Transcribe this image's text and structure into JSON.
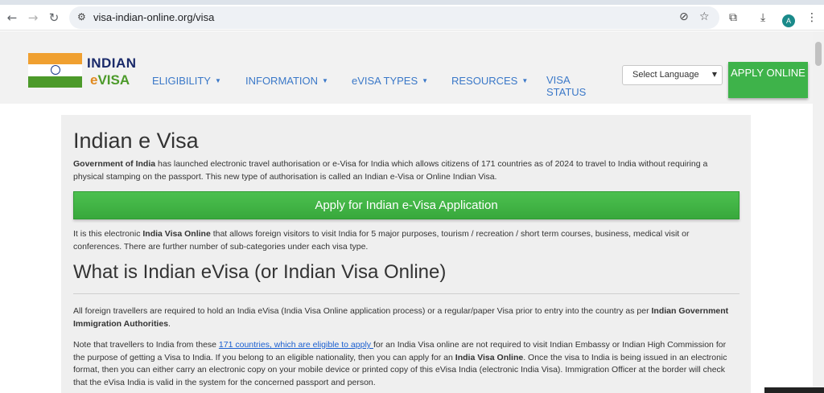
{
  "browser": {
    "url": "visa-indian-online.org/visa",
    "avatar_letter": "A"
  },
  "header": {
    "brand_line1": "INDIAN",
    "brand_line2_e": "e",
    "brand_line2_visa": "VISA",
    "nav": [
      {
        "label": "ELIGIBILITY"
      },
      {
        "label": "INFORMATION"
      },
      {
        "label": "eVISA TYPES"
      },
      {
        "label": "RESOURCES"
      }
    ],
    "visa_status": "VISA STATUS",
    "language_select": "Select Language",
    "apply_online": "APPLY ONLINE"
  },
  "main": {
    "title": "Indian e Visa",
    "intro_bold": "Government of India",
    "intro_rest": " has launched electronic travel authorisation or e-Visa for India which allows citizens of 171 countries as of 2024 to travel to India without requiring a physical stamping on the passport. This new type of authorisation is called an Indian e-Visa or Online Indian Visa.",
    "apply_button": "Apply for Indian e-Visa Application",
    "p2_start": "It is this electronic ",
    "p2_bold": "India Visa Online",
    "p2_rest": " that allows foreign visitors to visit India for 5 major purposes, tourism / recreation / short term courses, business, medical visit or conferences. There are further number of sub-categories under each visa type.",
    "h2": "What is Indian eVisa (or Indian Visa Online)",
    "p3_start": "All foreign travellers are required to hold an India eVisa (India Visa Online application process) or a regular/paper Visa prior to entry into the country as per ",
    "p3_bold": "Indian Government Immigration Authorities",
    "p3_end": ".",
    "p4_start": "Note that travellers to India from these ",
    "p4_link": "171 countries, which are eligible to apply ",
    "p4_mid": "for an India Visa online are not required to visit Indian Embassy or Indian High Commission for the purpose of getting a Visa to India. If you belong to an eligible nationality, then you can apply for an ",
    "p4_bold": "India Visa Online",
    "p4_rest": ". Once the visa to India is being issued in an electronic format, then you can either carry an electronic copy on your mobile device or printed copy of this eVisa India (electronic India Visa). Immigration Officer at the border will check that the eVisa India is valid in the system for the concerned passport and person."
  },
  "colors": {
    "accent_green": "#3eb34a",
    "nav_blue": "#3a78c8",
    "brand_navy": "#1a2a6a",
    "link_blue": "#1a5fd0"
  },
  "icons": [
    "back-arrow-icon",
    "forward-arrow-icon",
    "reload-icon",
    "site-info-icon",
    "eye-off-icon",
    "star-icon",
    "extensions-icon",
    "download-icon",
    "more-icon"
  ]
}
